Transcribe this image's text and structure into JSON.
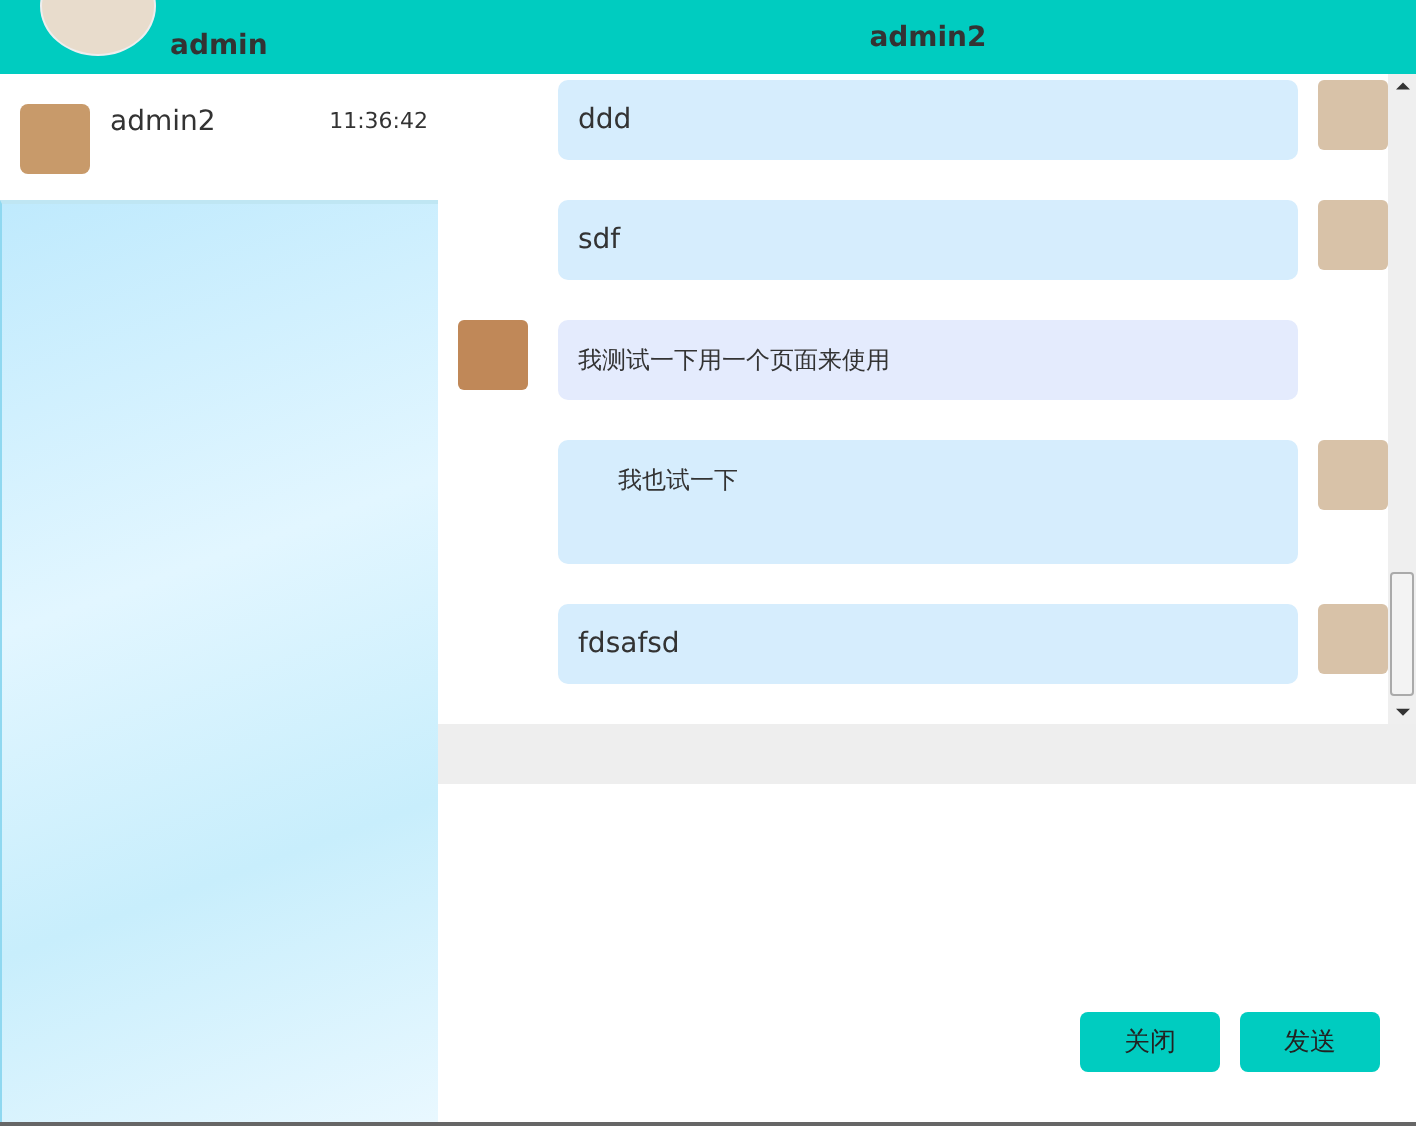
{
  "header": {
    "user_name": "admin",
    "chat_title": "admin2"
  },
  "contacts": [
    {
      "name": "admin2",
      "time": "11:36:42",
      "selected": false
    }
  ],
  "messages": [
    {
      "kind": "sent",
      "text": "ddd",
      "indented": false
    },
    {
      "kind": "sent",
      "text": "sdf",
      "indented": false
    },
    {
      "kind": "received",
      "text": "我测试一下用一个页面来使用",
      "indented": false
    },
    {
      "kind": "sent",
      "text": "我也试一下",
      "indented": true
    },
    {
      "kind": "sent",
      "text": "fdsafsd",
      "indented": false
    }
  ],
  "buttons": [
    "关闭",
    "发送"
  ]
}
